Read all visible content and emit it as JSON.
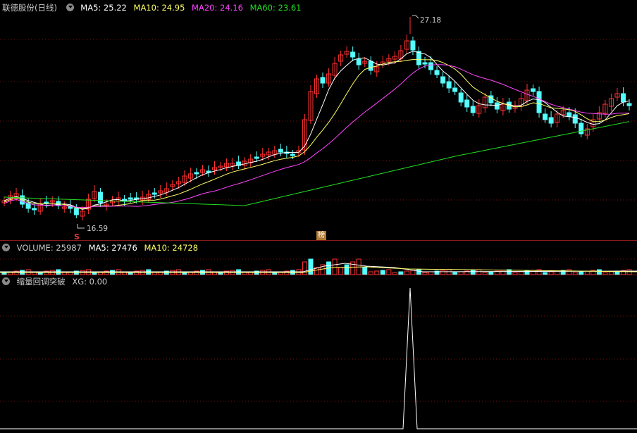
{
  "main": {
    "stock_name": "联德股份(日线)",
    "ma5": "MA5: 25.22",
    "ma10": "MA10: 24.95",
    "ma20": "MA20: 24.16",
    "ma60": "MA60: 23.61",
    "high_label": "27.18",
    "low_label": "16.59",
    "signal_label": "S",
    "bang_label": "榜"
  },
  "volume": {
    "volume": "VOLUME: 25987",
    "ma5": "MA5: 27476",
    "ma10": "MA10: 24728"
  },
  "indicator": {
    "name": "缩量回调突破",
    "xg": "XG: 0.00"
  },
  "colors": {
    "up": "#ff3232",
    "down": "#54ffff",
    "ma5": "#ffffff",
    "ma10": "#ffff66",
    "ma20": "#ff44ff",
    "ma60": "#22dd22",
    "grid": "#7a1010"
  }
}
